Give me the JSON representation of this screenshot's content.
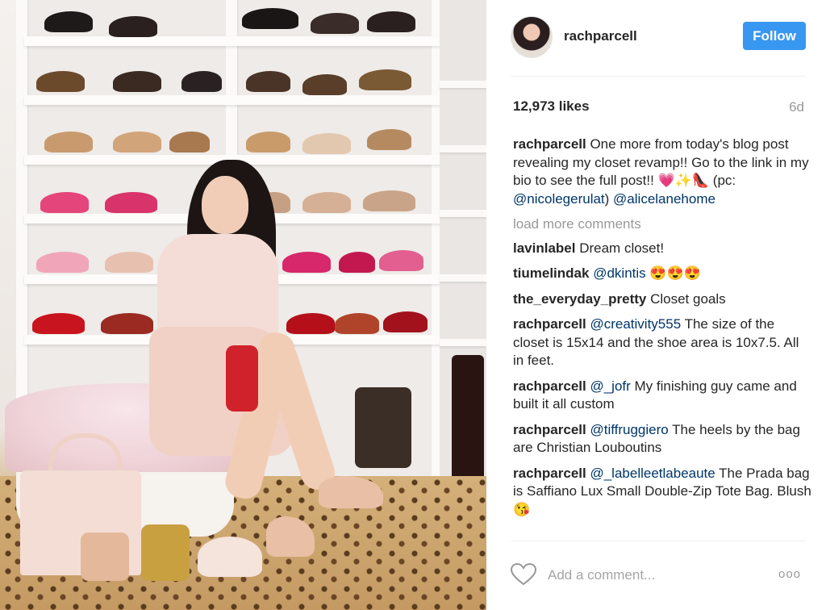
{
  "post": {
    "username": "rachparcell",
    "follow_label": "Follow",
    "likes": "12,973 likes",
    "age": "6d"
  },
  "caption": {
    "author": "rachparcell",
    "text_1": " One more from today's blog post revealing my closet revamp!! Go to the link in my bio to see the full post!! 💗✨👠 (pc: ",
    "mention_1": "@nicolegerulat",
    "text_2": ") ",
    "mention_2": "@alicelanehome"
  },
  "load_more": "load more comments",
  "comments": [
    {
      "author": "lavinlabel",
      "mention": "",
      "text": " Dream closet!"
    },
    {
      "author": "tiumelindak",
      "mention": "@dkintis",
      "text": " 😍😍😍"
    },
    {
      "author": "the_everyday_pretty",
      "mention": "",
      "text": " Closet goals"
    },
    {
      "author": "rachparcell",
      "mention": "@creativity555",
      "text": " The size of the closet is 15x14 and the shoe area is 10x7.5. All in feet."
    },
    {
      "author": "rachparcell",
      "mention": "@_jofr",
      "text": " My finishing guy came and built it all custom"
    },
    {
      "author": "rachparcell",
      "mention": "@tiffruggiero",
      "text": " The heels by the bag are Christian Louboutins"
    },
    {
      "author": "rachparcell",
      "mention": "@_labelleetlabeaute",
      "text": " The Prada bag is Saffiano Lux Small Double-Zip Tote Bag. Blush 😘"
    }
  ],
  "footer": {
    "add_comment_placeholder": "Add a comment...",
    "more_glyph": "ooo",
    "heart_icon": "heart-outline-icon"
  },
  "colors": {
    "follow_button": "#3897f0",
    "mention": "#003569",
    "muted": "#999999"
  }
}
